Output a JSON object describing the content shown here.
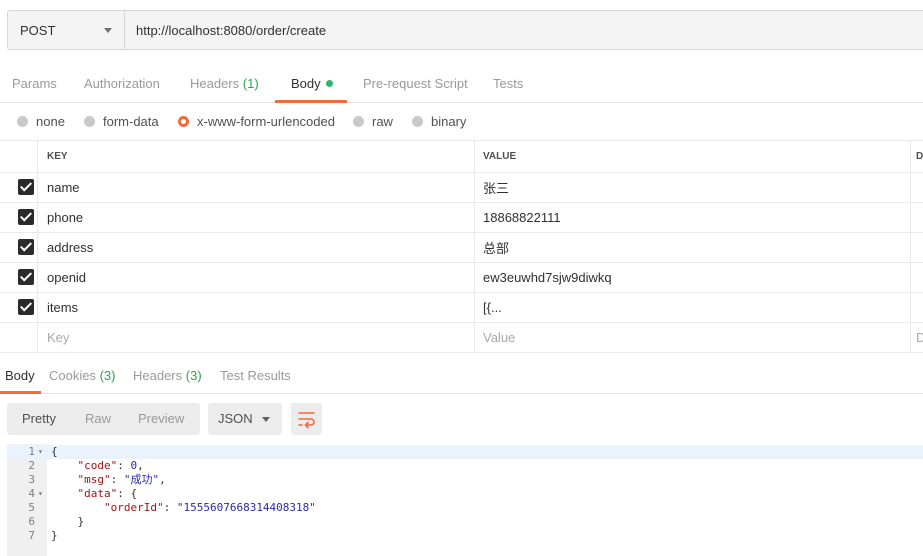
{
  "request": {
    "method": "POST",
    "url": "http://localhost:8080/order/create"
  },
  "request_tabs": [
    {
      "label": "Params"
    },
    {
      "label": "Authorization"
    },
    {
      "label": "Headers",
      "count": "(1)"
    },
    {
      "label": "Body"
    },
    {
      "label": "Pre-request Script"
    },
    {
      "label": "Tests"
    }
  ],
  "body_types": [
    "none",
    "form-data",
    "x-www-form-urlencoded",
    "raw",
    "binary"
  ],
  "selected_body_type": "x-www-form-urlencoded",
  "table": {
    "headers": {
      "key": "KEY",
      "value": "VALUE",
      "desc": "D"
    },
    "rows": [
      {
        "key": "name",
        "value": "张三",
        "checked": true
      },
      {
        "key": "phone",
        "value": "18868822111",
        "checked": true
      },
      {
        "key": "address",
        "value": "总部",
        "checked": true
      },
      {
        "key": "openid",
        "value": "ew3euwhd7sjw9diwkq",
        "checked": true
      },
      {
        "key": "items",
        "value": "[{...",
        "checked": true
      }
    ],
    "placeholders": {
      "key": "Key",
      "value": "Value",
      "desc": "D"
    }
  },
  "response_tabs": [
    {
      "label": "Body"
    },
    {
      "label": "Cookies",
      "count": "(3)"
    },
    {
      "label": "Headers",
      "count": "(3)"
    },
    {
      "label": "Test Results"
    }
  ],
  "view_modes": [
    "Pretty",
    "Raw",
    "Preview"
  ],
  "format": "JSON",
  "icons": {
    "wrap": "wrap-lines-icon"
  },
  "colors": {
    "accent": "#f26b3a",
    "success": "#2fb46e"
  },
  "response_lines": [
    {
      "num": "1",
      "fold": "▾"
    },
    {
      "num": "2"
    },
    {
      "num": "3"
    },
    {
      "num": "4",
      "fold": "▾"
    },
    {
      "num": "5"
    },
    {
      "num": "6"
    },
    {
      "num": "7"
    }
  ],
  "response_json": {
    "open": "{",
    "code_key": "\"code\"",
    "code_val": "0",
    "msg_key": "\"msg\"",
    "msg_val": "\"成功\"",
    "data_key": "\"data\"",
    "orderId_key": "\"orderId\"",
    "orderId_val": "\"1555607668314408318\"",
    "inner_close": "}",
    "close": "}"
  }
}
